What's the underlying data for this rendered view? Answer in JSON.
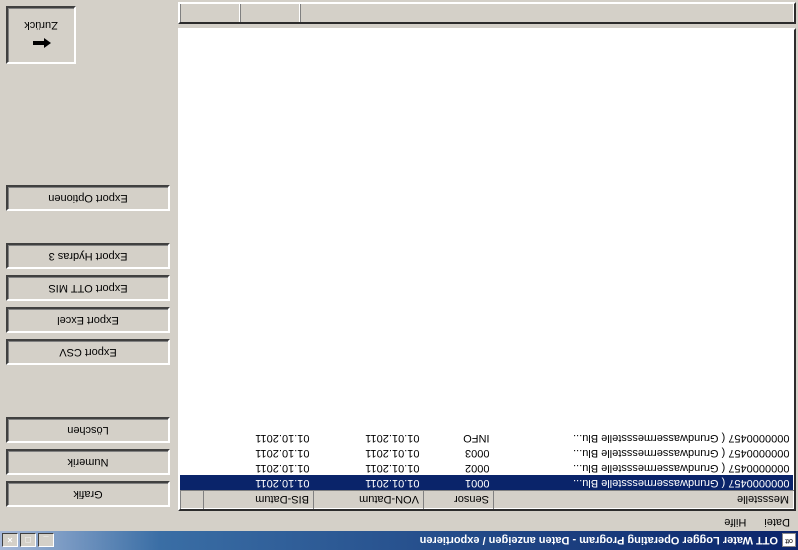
{
  "title": "OTT Water Logger Operating Program  -  Daten anzeigen / exportieren",
  "app_icon_text": "ott",
  "menu": {
    "datei": "Datei",
    "hilfe": "Hilfe"
  },
  "columns": {
    "messstelle": "Messstelle",
    "sensor": "Sensor",
    "von": "VON-Datum",
    "bis": "BIS-Datum"
  },
  "rows": [
    {
      "mess": "0000000457  ( Grundwassermessstelle Blu...",
      "sensor": "0001",
      "von": "01.01.2011",
      "bis": "01.10.2011",
      "selected": true
    },
    {
      "mess": "0000000457  ( Grundwassermessstelle Blu...",
      "sensor": "0002",
      "von": "01.01.2011",
      "bis": "01.10.2011",
      "selected": false
    },
    {
      "mess": "0000000457  ( Grundwassermessstelle Blu...",
      "sensor": "0003",
      "von": "01.01.2011",
      "bis": "01.10.2011",
      "selected": false
    },
    {
      "mess": "0000000457  ( Grundwassermessstelle Blu...",
      "sensor": "INFO",
      "von": "01.01.2011",
      "bis": "01.10.2011",
      "selected": false
    }
  ],
  "buttons": {
    "grafik": "Grafik",
    "numerik": "Numerik",
    "loeschen": "Löschen",
    "export_csv": "Export CSV",
    "export_excel": "Export Excel",
    "export_ott_mis": "Export OTT MIS",
    "export_hydras3": "Export Hydras 3",
    "export_optionen": "Export Optionen",
    "zurueck": "Zurück"
  }
}
